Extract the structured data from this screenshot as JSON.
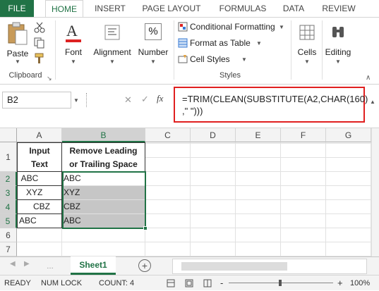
{
  "ribbon_tabs": [
    "FILE",
    "HOME",
    "INSERT",
    "PAGE LAYOUT",
    "FORMULAS",
    "DATA",
    "REVIEW"
  ],
  "ribbon": {
    "paste": "Paste",
    "clipboard": "Clipboard",
    "font": "Font",
    "alignment": "Alignment",
    "number": "Number",
    "conditional_formatting": "Conditional Formatting",
    "format_as_table": "Format as Table",
    "cell_styles": "Cell Styles",
    "styles": "Styles",
    "cells": "Cells",
    "editing": "Editing",
    "number_icon": "%"
  },
  "formula_bar": {
    "name_box": "B2",
    "fx": "fx",
    "formula_line1": "=TRIM(CLEAN(SUBSTITUTE(A2,CHAR(160)",
    "formula_line2": ",\" \")))"
  },
  "columns": [
    "A",
    "B",
    "C",
    "D",
    "E",
    "F",
    "G"
  ],
  "rows": [
    "1",
    "2",
    "3",
    "4",
    "5",
    "6",
    "7"
  ],
  "header": {
    "a1_line1": "Input",
    "a1_line2": "Text",
    "b1_line1": "Remove Leading",
    "b1_line2": "or Trailing Space"
  },
  "data_rows": [
    {
      "a": " ABC",
      "b": "ABC"
    },
    {
      "a": "   XYZ",
      "b": "XYZ"
    },
    {
      "a": "      CBZ",
      "b": "CBZ"
    },
    {
      "a": "ABC",
      "b": "ABC"
    }
  ],
  "sheet_tab": "Sheet1",
  "add_sheet": "+",
  "status": {
    "ready": "READY",
    "num_lock": "NUM LOCK",
    "count": "COUNT: 4",
    "zoom_minus": "-",
    "zoom_plus": "+",
    "zoom": "100%"
  },
  "colors": {
    "accent": "#217346",
    "highlight": "#e02020"
  }
}
